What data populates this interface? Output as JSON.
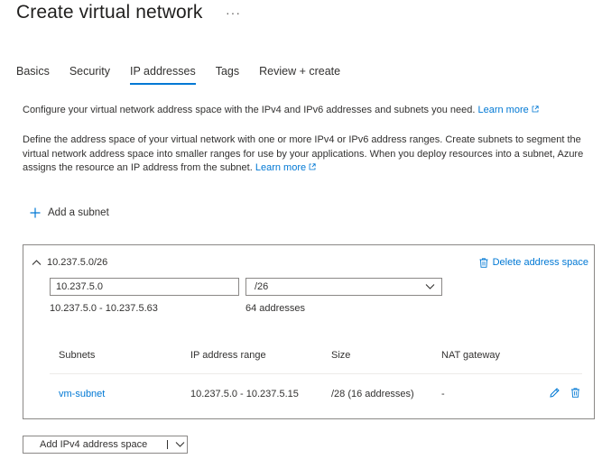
{
  "header": {
    "title": "Create virtual network",
    "more": "···"
  },
  "tabs": [
    {
      "label": "Basics",
      "active": false
    },
    {
      "label": "Security",
      "active": false
    },
    {
      "label": "IP addresses",
      "active": true
    },
    {
      "label": "Tags",
      "active": false
    },
    {
      "label": "Review + create",
      "active": false
    }
  ],
  "intro": {
    "text1": "Configure your virtual network address space with the IPv4 and IPv6 addresses and subnets you need.",
    "learn_more_1": "Learn more",
    "text2": "Define the address space of your virtual network with one or more IPv4 or IPv6 address ranges. Create subnets to segment the virtual network address space into smaller ranges for use by your applications. When you deploy resources into a subnet, Azure assigns the resource an IP address from the subnet.",
    "learn_more_2": "Learn more"
  },
  "add_subnet_label": "Add a subnet",
  "address_space": {
    "header": "10.237.5.0/26",
    "delete_label": "Delete address space",
    "address_value": "10.237.5.0",
    "prefix_value": "/26",
    "range": "10.237.5.0 - 10.237.5.63",
    "count": "64 addresses",
    "table": {
      "headers": {
        "subnets": "Subnets",
        "ip_range": "IP address range",
        "size": "Size",
        "nat": "NAT gateway"
      },
      "rows": [
        {
          "name": "vm-subnet",
          "ip_range": "10.237.5.0 - 10.237.5.15",
          "size": "/28 (16 addresses)",
          "nat": "-"
        }
      ]
    }
  },
  "add_ipv4_label": "Add IPv4 address space",
  "colors": {
    "accent": "#0078d4",
    "text": "#323130",
    "border": "#8a8886"
  }
}
